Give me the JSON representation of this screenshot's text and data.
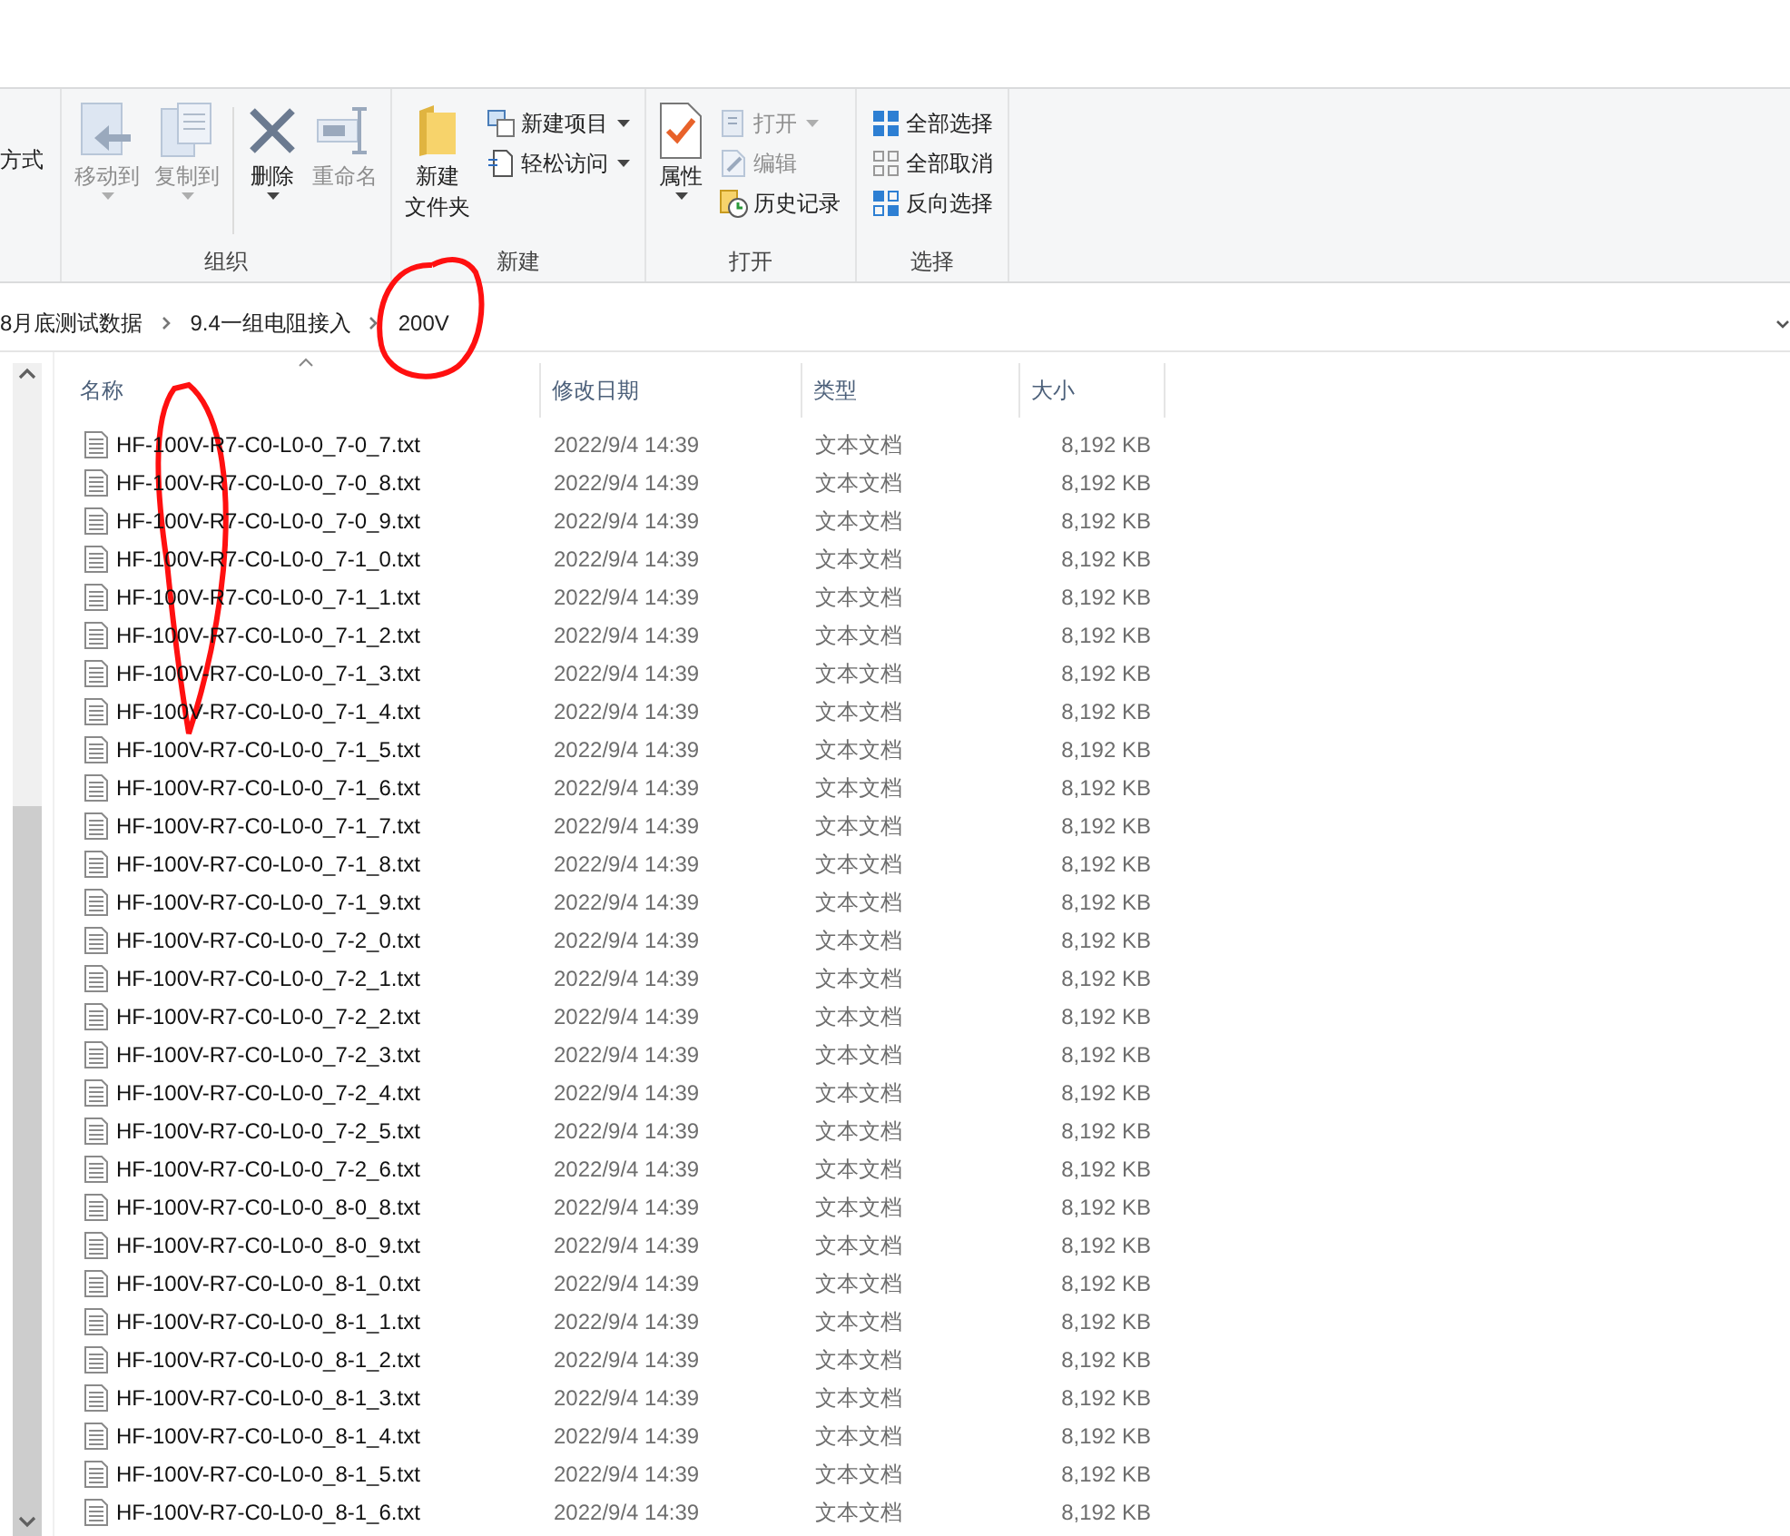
{
  "ribbon": {
    "cut_label": "方式",
    "groups": [
      {
        "label": "组织",
        "items": [
          {
            "kind": "large",
            "label": "移动到",
            "disabled": true,
            "dropdown": true
          },
          {
            "kind": "large",
            "label": "复制到",
            "disabled": true,
            "dropdown": true
          },
          {
            "kind": "large",
            "label": "删除",
            "disabled": false,
            "dropdown": true
          },
          {
            "kind": "large",
            "label": "重命名",
            "disabled": true,
            "dropdown": false
          }
        ]
      },
      {
        "label": "新建",
        "items": [
          {
            "kind": "large",
            "label_lines": [
              "新建",
              "文件夹"
            ],
            "disabled": false,
            "dropdown": false
          },
          {
            "kind": "stack",
            "items": [
              {
                "label": "新建项目",
                "disabled": false,
                "dropdown": true
              },
              {
                "label": "轻松访问",
                "disabled": false,
                "dropdown": true
              }
            ]
          }
        ]
      },
      {
        "label": "打开",
        "items": [
          {
            "kind": "large",
            "label": "属性",
            "disabled": false,
            "dropdown": true
          },
          {
            "kind": "stack",
            "items": [
              {
                "label": "打开",
                "disabled": true,
                "dropdown": true
              },
              {
                "label": "编辑",
                "disabled": true,
                "dropdown": false
              },
              {
                "label": "历史记录",
                "disabled": false,
                "dropdown": false
              }
            ]
          }
        ]
      },
      {
        "label": "选择",
        "items": [
          {
            "kind": "stack",
            "items": [
              {
                "label": "全部选择",
                "disabled": false,
                "dropdown": false
              },
              {
                "label": "全部取消",
                "disabled": false,
                "dropdown": false
              },
              {
                "label": "反向选择",
                "disabled": false,
                "dropdown": false
              }
            ]
          }
        ]
      }
    ]
  },
  "breadcrumb": [
    "8月底测试数据",
    "9.4一组电阻接入",
    "200V"
  ],
  "columns": [
    "名称",
    "修改日期",
    "类型",
    "大小"
  ],
  "files": [
    {
      "name": "HF-100V-R7-C0-L0-0_7-0_7.txt",
      "modified": "2022/9/4 14:39",
      "type": "文本文档",
      "size": "8,192 KB"
    },
    {
      "name": "HF-100V-R7-C0-L0-0_7-0_8.txt",
      "modified": "2022/9/4 14:39",
      "type": "文本文档",
      "size": "8,192 KB"
    },
    {
      "name": "HF-100V-R7-C0-L0-0_7-0_9.txt",
      "modified": "2022/9/4 14:39",
      "type": "文本文档",
      "size": "8,192 KB"
    },
    {
      "name": "HF-100V-R7-C0-L0-0_7-1_0.txt",
      "modified": "2022/9/4 14:39",
      "type": "文本文档",
      "size": "8,192 KB"
    },
    {
      "name": "HF-100V-R7-C0-L0-0_7-1_1.txt",
      "modified": "2022/9/4 14:39",
      "type": "文本文档",
      "size": "8,192 KB"
    },
    {
      "name": "HF-100V-R7-C0-L0-0_7-1_2.txt",
      "modified": "2022/9/4 14:39",
      "type": "文本文档",
      "size": "8,192 KB"
    },
    {
      "name": "HF-100V-R7-C0-L0-0_7-1_3.txt",
      "modified": "2022/9/4 14:39",
      "type": "文本文档",
      "size": "8,192 KB"
    },
    {
      "name": "HF-100V-R7-C0-L0-0_7-1_4.txt",
      "modified": "2022/9/4 14:39",
      "type": "文本文档",
      "size": "8,192 KB"
    },
    {
      "name": "HF-100V-R7-C0-L0-0_7-1_5.txt",
      "modified": "2022/9/4 14:39",
      "type": "文本文档",
      "size": "8,192 KB"
    },
    {
      "name": "HF-100V-R7-C0-L0-0_7-1_6.txt",
      "modified": "2022/9/4 14:39",
      "type": "文本文档",
      "size": "8,192 KB"
    },
    {
      "name": "HF-100V-R7-C0-L0-0_7-1_7.txt",
      "modified": "2022/9/4 14:39",
      "type": "文本文档",
      "size": "8,192 KB"
    },
    {
      "name": "HF-100V-R7-C0-L0-0_7-1_8.txt",
      "modified": "2022/9/4 14:39",
      "type": "文本文档",
      "size": "8,192 KB"
    },
    {
      "name": "HF-100V-R7-C0-L0-0_7-1_9.txt",
      "modified": "2022/9/4 14:39",
      "type": "文本文档",
      "size": "8,192 KB"
    },
    {
      "name": "HF-100V-R7-C0-L0-0_7-2_0.txt",
      "modified": "2022/9/4 14:39",
      "type": "文本文档",
      "size": "8,192 KB"
    },
    {
      "name": "HF-100V-R7-C0-L0-0_7-2_1.txt",
      "modified": "2022/9/4 14:39",
      "type": "文本文档",
      "size": "8,192 KB"
    },
    {
      "name": "HF-100V-R7-C0-L0-0_7-2_2.txt",
      "modified": "2022/9/4 14:39",
      "type": "文本文档",
      "size": "8,192 KB"
    },
    {
      "name": "HF-100V-R7-C0-L0-0_7-2_3.txt",
      "modified": "2022/9/4 14:39",
      "type": "文本文档",
      "size": "8,192 KB"
    },
    {
      "name": "HF-100V-R7-C0-L0-0_7-2_4.txt",
      "modified": "2022/9/4 14:39",
      "type": "文本文档",
      "size": "8,192 KB"
    },
    {
      "name": "HF-100V-R7-C0-L0-0_7-2_5.txt",
      "modified": "2022/9/4 14:39",
      "type": "文本文档",
      "size": "8,192 KB"
    },
    {
      "name": "HF-100V-R7-C0-L0-0_7-2_6.txt",
      "modified": "2022/9/4 14:39",
      "type": "文本文档",
      "size": "8,192 KB"
    },
    {
      "name": "HF-100V-R7-C0-L0-0_8-0_8.txt",
      "modified": "2022/9/4 14:39",
      "type": "文本文档",
      "size": "8,192 KB"
    },
    {
      "name": "HF-100V-R7-C0-L0-0_8-0_9.txt",
      "modified": "2022/9/4 14:39",
      "type": "文本文档",
      "size": "8,192 KB"
    },
    {
      "name": "HF-100V-R7-C0-L0-0_8-1_0.txt",
      "modified": "2022/9/4 14:39",
      "type": "文本文档",
      "size": "8,192 KB"
    },
    {
      "name": "HF-100V-R7-C0-L0-0_8-1_1.txt",
      "modified": "2022/9/4 14:39",
      "type": "文本文档",
      "size": "8,192 KB"
    },
    {
      "name": "HF-100V-R7-C0-L0-0_8-1_2.txt",
      "modified": "2022/9/4 14:39",
      "type": "文本文档",
      "size": "8,192 KB"
    },
    {
      "name": "HF-100V-R7-C0-L0-0_8-1_3.txt",
      "modified": "2022/9/4 14:39",
      "type": "文本文档",
      "size": "8,192 KB"
    },
    {
      "name": "HF-100V-R7-C0-L0-0_8-1_4.txt",
      "modified": "2022/9/4 14:39",
      "type": "文本文档",
      "size": "8,192 KB"
    },
    {
      "name": "HF-100V-R7-C0-L0-0_8-1_5.txt",
      "modified": "2022/9/4 14:39",
      "type": "文本文档",
      "size": "8,192 KB"
    },
    {
      "name": "HF-100V-R7-C0-L0-0_8-1_6.txt",
      "modified": "2022/9/4 14:39",
      "type": "文本文档",
      "size": "8,192 KB"
    }
  ]
}
